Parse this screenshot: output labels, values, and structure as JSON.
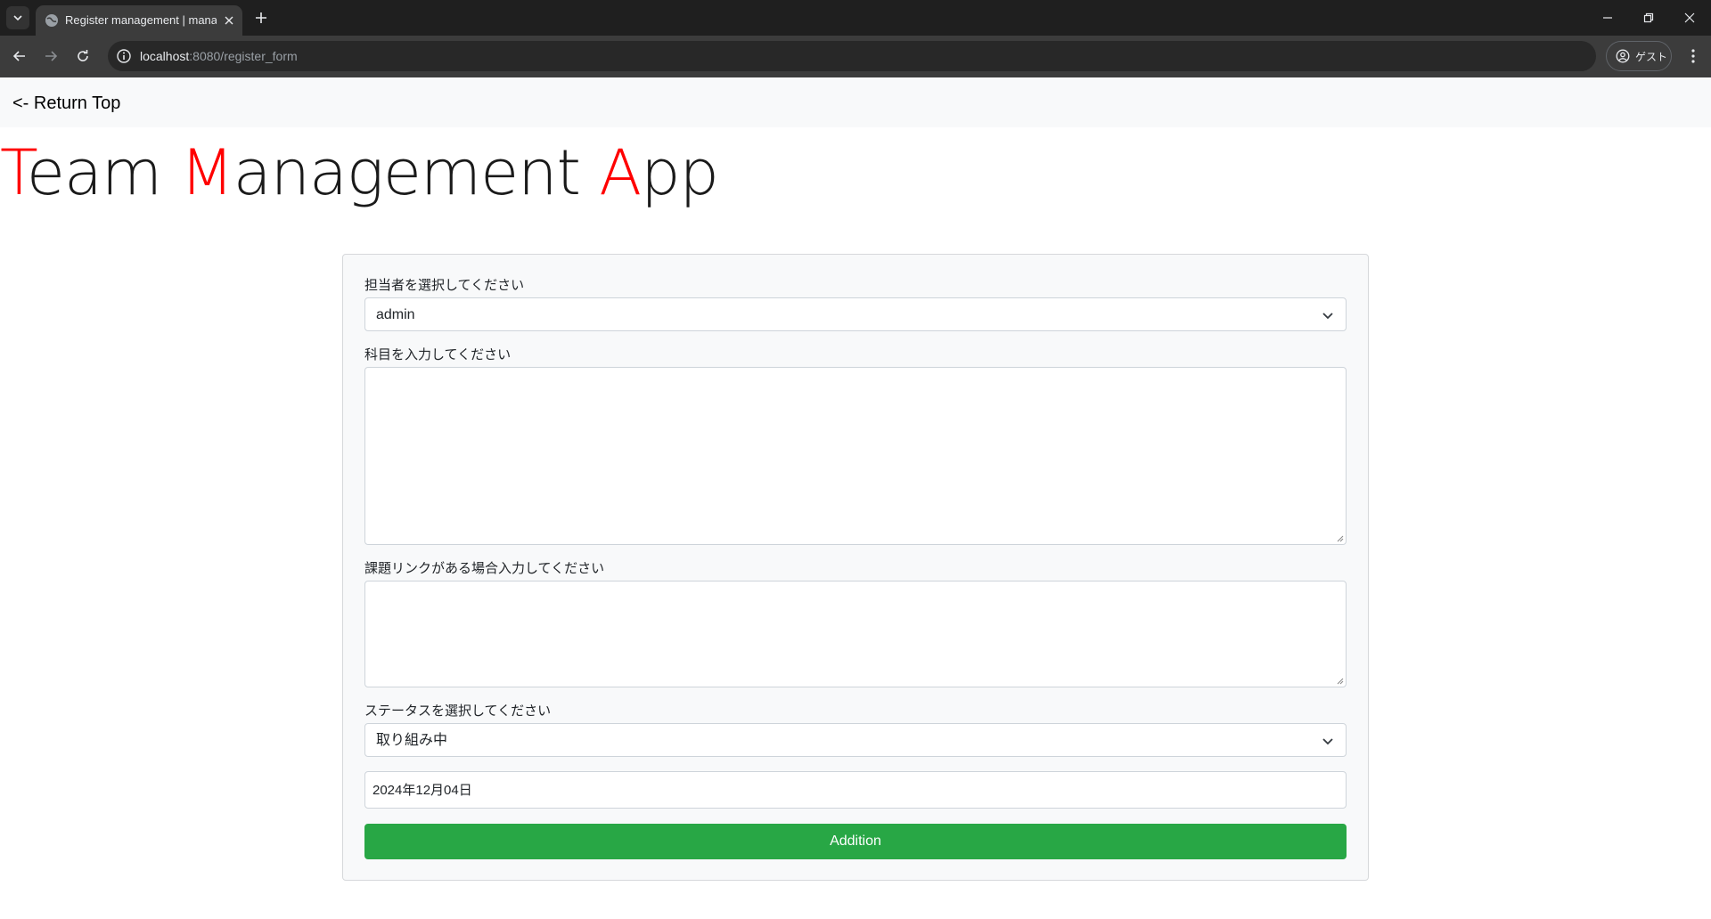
{
  "browser": {
    "tab_title": "Register management | manage",
    "url_host": "localhost",
    "url_path": ":8080/register_form",
    "profile_label": "ゲスト"
  },
  "nav": {
    "return_label": "<- Return Top"
  },
  "title": {
    "part1_initial": "T",
    "part1_rest": "eam ",
    "part2_initial": "M",
    "part2_rest": "anagement ",
    "part3_initial": "A",
    "part3_rest": "pp",
    "accent_color": "#ff0000"
  },
  "form": {
    "assignee_label": "担当者を選択してください",
    "assignee_value": "admin",
    "subject_label": "科目を入力してください",
    "subject_value": "",
    "link_label": "課題リンクがある場合入力してください",
    "link_value": "",
    "status_label": "ステータスを選択してください",
    "status_value": "取り組み中",
    "date_value": "2024年12月04日",
    "submit_label": "Addition",
    "submit_color": "#28a745"
  }
}
